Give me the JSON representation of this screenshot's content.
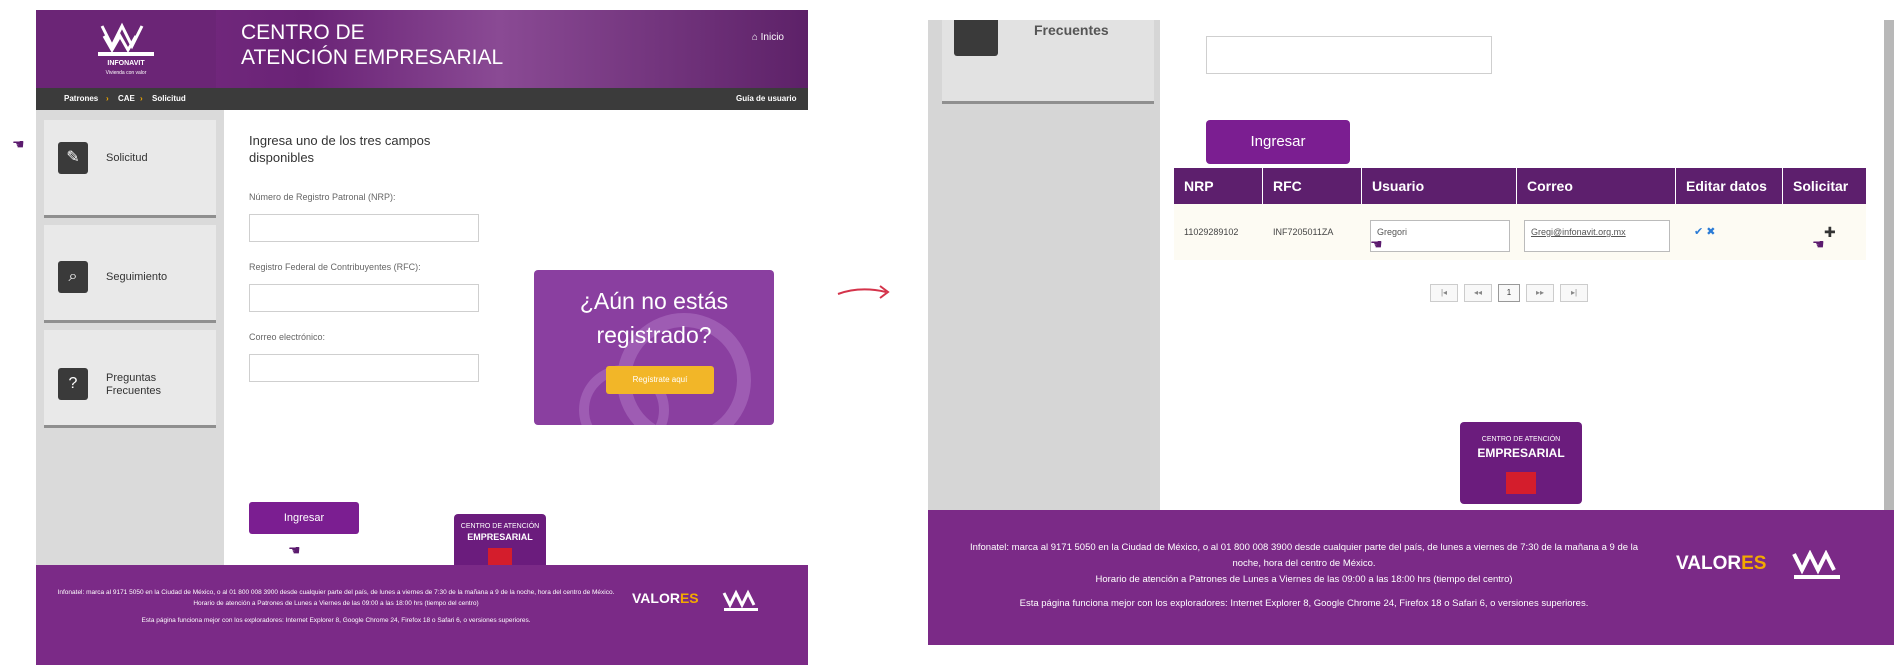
{
  "left": {
    "logo": {
      "brand": "INFONAVIT",
      "tagline": "Vivienda con valor"
    },
    "header": {
      "title_line1": "CENTRO DE",
      "title_line2": "ATENCIÓN EMPRESARIAL",
      "home_link": "Inicio"
    },
    "breadcrumb": {
      "items": [
        "Patrones",
        "CAE",
        "Solicitud"
      ],
      "guide_link": "Guía de usuario"
    },
    "sidebar": {
      "items": [
        {
          "label": "Solicitud",
          "icon": "request-icon"
        },
        {
          "label": "Seguimiento",
          "icon": "tracking-icon"
        },
        {
          "label": "Preguntas Frecuentes",
          "icon": "faq-icon"
        }
      ]
    },
    "form": {
      "instructions": "Ingresa uno de los tres campos disponibles",
      "nrp_label": "Número de Registro Patronal (NRP):",
      "rfc_label": "Registro Federal de Contribuyentes (RFC):",
      "email_label": "Correo electrónico:",
      "nrp_value": "",
      "rfc_value": "",
      "email_value": "",
      "submit_label": "Ingresar"
    },
    "promo": {
      "title": "¿Aún no estás registrado?",
      "button_label": "Regístrate aquí"
    },
    "cae_badge": {
      "line1": "CENTRO DE ATENCIÓN",
      "line2": "EMPRESARIAL"
    },
    "footer": {
      "line1": "Infonatel: marca al 9171 5050 en la Ciudad de México, o al 01 800 008 3900 desde cualquier parte del país, de lunes a viernes de 7:30 de la mañana a 9 de la noche, hora del centro de México.",
      "line2": "Horario de atención a Patrones de Lunes a Viernes de las 09:00 a las 18:00 hrs (tiempo del centro)",
      "line3": "Esta página funciona mejor con los exploradores: Internet Explorer 8, Google Chrome 24, Firefox 18 o Safari 6, o versiones superiores.",
      "values_main": "VALOR",
      "values_accent": "ES"
    }
  },
  "right": {
    "sidebar": {
      "item_label": "Frecuentes",
      "icon": "faq-icon"
    },
    "search_value": "",
    "submit_label": "Ingresar",
    "table": {
      "headers": [
        "NRP",
        "RFC",
        "Usuario",
        "Correo",
        "Editar datos",
        "Solicitar"
      ],
      "rows": [
        {
          "nrp": "11029289102",
          "rfc": "INF7205011ZA",
          "usuario": "Gregori",
          "correo": "Gregi@infonavit.org.mx",
          "edit_icons": "✔ ✖",
          "request_icon": "✚"
        }
      ]
    },
    "pager": {
      "first": "|◂",
      "prev": "◂◂",
      "page": "1",
      "next": "▸▸",
      "last": "▸|"
    },
    "cae_badge": {
      "line1": "CENTRO DE ATENCIÓN",
      "line2": "EMPRESARIAL"
    },
    "footer": {
      "line1": "Infonatel: marca al 9171 5050 en la Ciudad de México, o al 01 800 008 3900 desde cualquier parte del país, de lunes a viernes de 7:30 de la mañana a 9 de la noche, hora del centro de México.",
      "line2": "Horario de atención a Patrones de Lunes a Viernes de las 09:00 a las 18:00 hrs (tiempo del centro)",
      "line3": "Esta página funciona mejor con los exploradores: Internet Explorer 8, Google Chrome 24, Firefox 18 o Safari 6, o versiones superiores.",
      "values_main": "VALOR",
      "values_accent": "ES"
    }
  },
  "colors": {
    "primary_purple": "#7b1e91",
    "dark_purple": "#5d1f6d",
    "accent_yellow": "#f2b628",
    "arrow_red": "#d4334a"
  }
}
